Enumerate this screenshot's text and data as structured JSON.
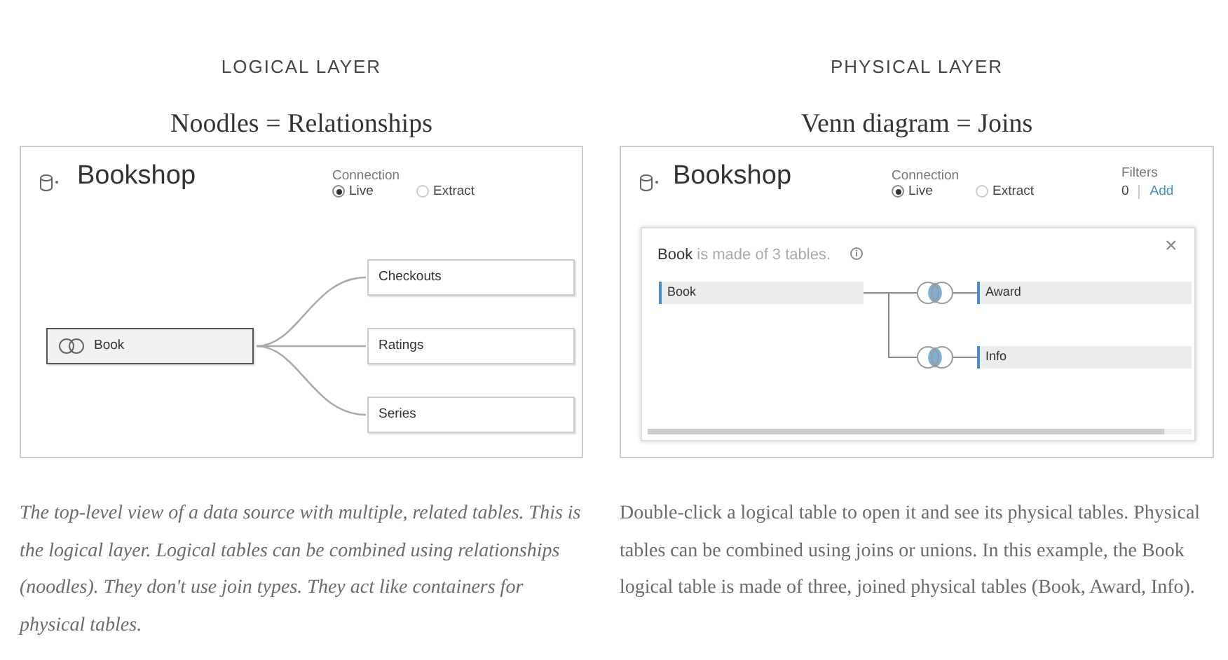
{
  "columns": [
    {
      "heading": "LOGICAL LAYER",
      "subheading": "Noodles = Relationships",
      "screenshot": {
        "kind": "logical",
        "title": "Bookshop",
        "connection": {
          "label": "Connection",
          "options": [
            {
              "label": "Live",
              "selected": true
            },
            {
              "label": "Extract",
              "selected": false
            }
          ]
        },
        "root": "Book",
        "children": [
          "Checkouts",
          "Ratings",
          "Series"
        ]
      },
      "caption": "The top-level view of a data source with multiple, related tables. This is the logical layer. Logical tables can be combined using relationships (noodles). They don't use join types. They act like containers for physical tables.",
      "caption_italic": true
    },
    {
      "heading": "PHYSICAL LAYER",
      "subheading": "Venn diagram = Joins",
      "screenshot": {
        "kind": "physical",
        "title": "Bookshop",
        "connection": {
          "label": "Connection",
          "options": [
            {
              "label": "Live",
              "selected": true
            },
            {
              "label": "Extract",
              "selected": false
            }
          ]
        },
        "filters": {
          "label": "Filters",
          "count": "0",
          "action": "Add"
        },
        "panel": {
          "name": "Book",
          "text": "is made of 3 tables.",
          "close": "×",
          "base": "Book",
          "joined": [
            "Award",
            "Info"
          ]
        }
      },
      "caption": "Double-click a logical table to open it and see its physical tables. Physical tables can be combined using joins or unions. In this example, the Book logical table is made of three, joined physical tables (Book, Award, Info).",
      "caption_italic": false
    }
  ]
}
